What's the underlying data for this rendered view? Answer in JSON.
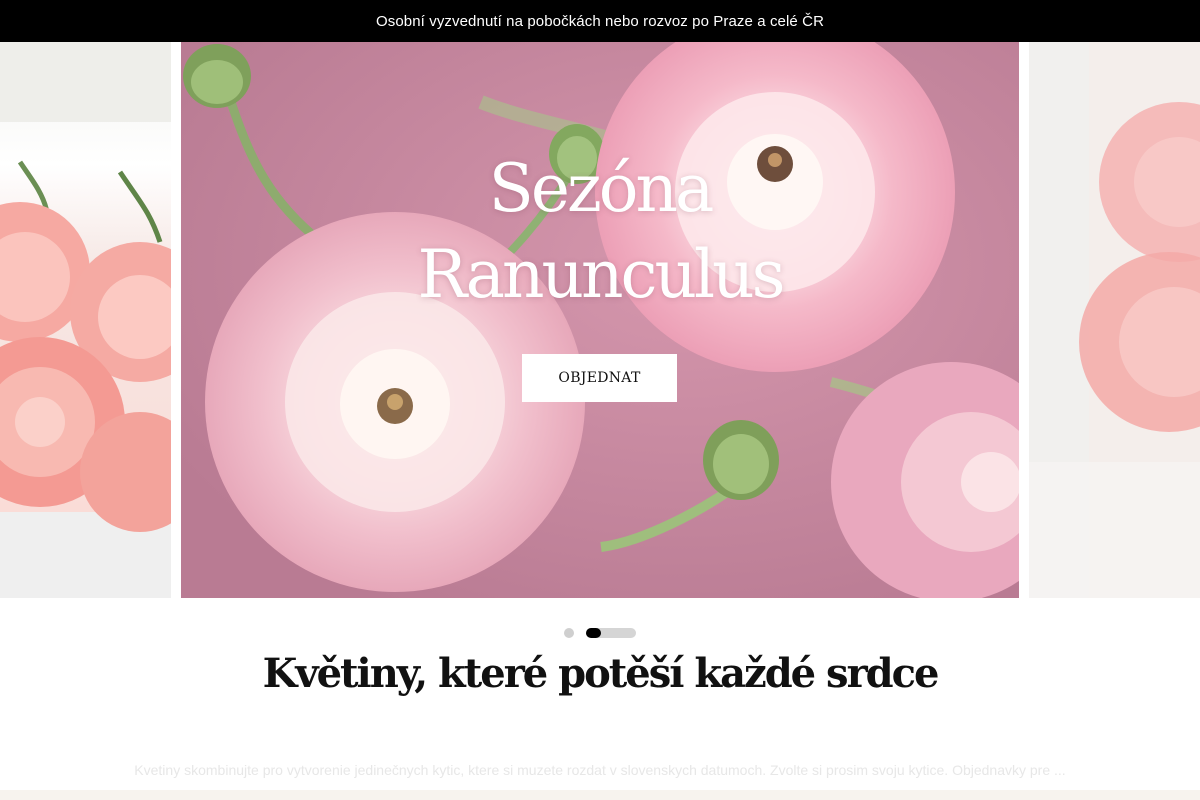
{
  "announcement": {
    "text": "Osobní vyzvednutí na pobočkách nebo rozvoz po Praze a celé ČR"
  },
  "hero": {
    "title_line1": "Sezóna",
    "title_line2": "Ranunculus",
    "button_label": "OBJEDNAT",
    "image_subject": "pink ranunculus flowers",
    "slide_count": 2,
    "active_slide": 2
  },
  "section": {
    "headline": "Květiny, které potěší každé srdce",
    "faded_text": "Kvetiny skombinujte pro vytvorenie jedinečnych kytic, ktere si muzete rozdat v slovenskych datumoch. Zvolte si prosim svoju kytice. Objednavky pre ..."
  },
  "colors": {
    "announcement_bg": "#000000",
    "button_bg": "#ffffff",
    "dot_active": "#000000",
    "dot_inactive": "#cfcfcf"
  }
}
